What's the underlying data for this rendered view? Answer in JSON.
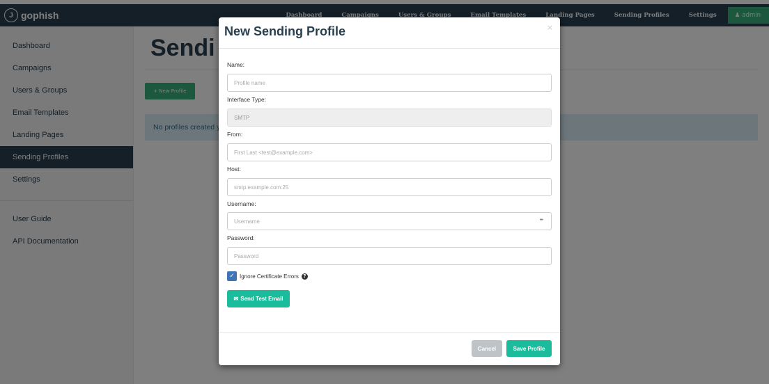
{
  "navbar": {
    "brand": "gophish",
    "links": [
      "Dashboard",
      "Campaigns",
      "Users & Groups",
      "Email Templates",
      "Landing Pages",
      "Sending Profiles",
      "Settings"
    ],
    "admin_label": "admin"
  },
  "sidebar": {
    "items": [
      "Dashboard",
      "Campaigns",
      "Users & Groups",
      "Email Templates",
      "Landing Pages",
      "Sending Profiles",
      "Settings"
    ],
    "active_index": 5,
    "help_items": [
      "User Guide",
      "API Documentation"
    ]
  },
  "main": {
    "title": "Sendi",
    "new_profile_label": "New Profile",
    "alert_text": "No profiles created y"
  },
  "modal": {
    "title": "New Sending Profile",
    "close": "×",
    "fields": {
      "name": {
        "label": "Name:",
        "placeholder": "Profile name",
        "value": ""
      },
      "interface_type": {
        "label": "Interface Type:",
        "value": "SMTP"
      },
      "from": {
        "label": "From:",
        "placeholder": "First Last <test@example.com>",
        "value": ""
      },
      "host": {
        "label": "Host:",
        "placeholder": "smtp.example.com:25",
        "value": ""
      },
      "username": {
        "label": "Username:",
        "placeholder": "Username",
        "value": "",
        "autofill_indicator": "•••"
      },
      "password": {
        "label": "Password:",
        "placeholder": "Password",
        "value": ""
      }
    },
    "ignore_cert_errors": {
      "label": "Ignore Certificate Errors",
      "checked": true
    },
    "send_test_label": "Send Test Email",
    "cancel_label": "Cancel",
    "save_label": "Save Profile"
  },
  "colors": {
    "navbar": "#283f50",
    "primary_green": "#37b07a",
    "teal": "#1abc9c",
    "checkbox": "#3f74b7",
    "cancel": "#bdc3c7",
    "alert_bg": "#d9edf7"
  },
  "icons": [
    "gophish-logo-icon",
    "user-icon",
    "plus-icon",
    "envelope-icon",
    "check-icon",
    "question-circle-icon",
    "close-icon"
  ]
}
